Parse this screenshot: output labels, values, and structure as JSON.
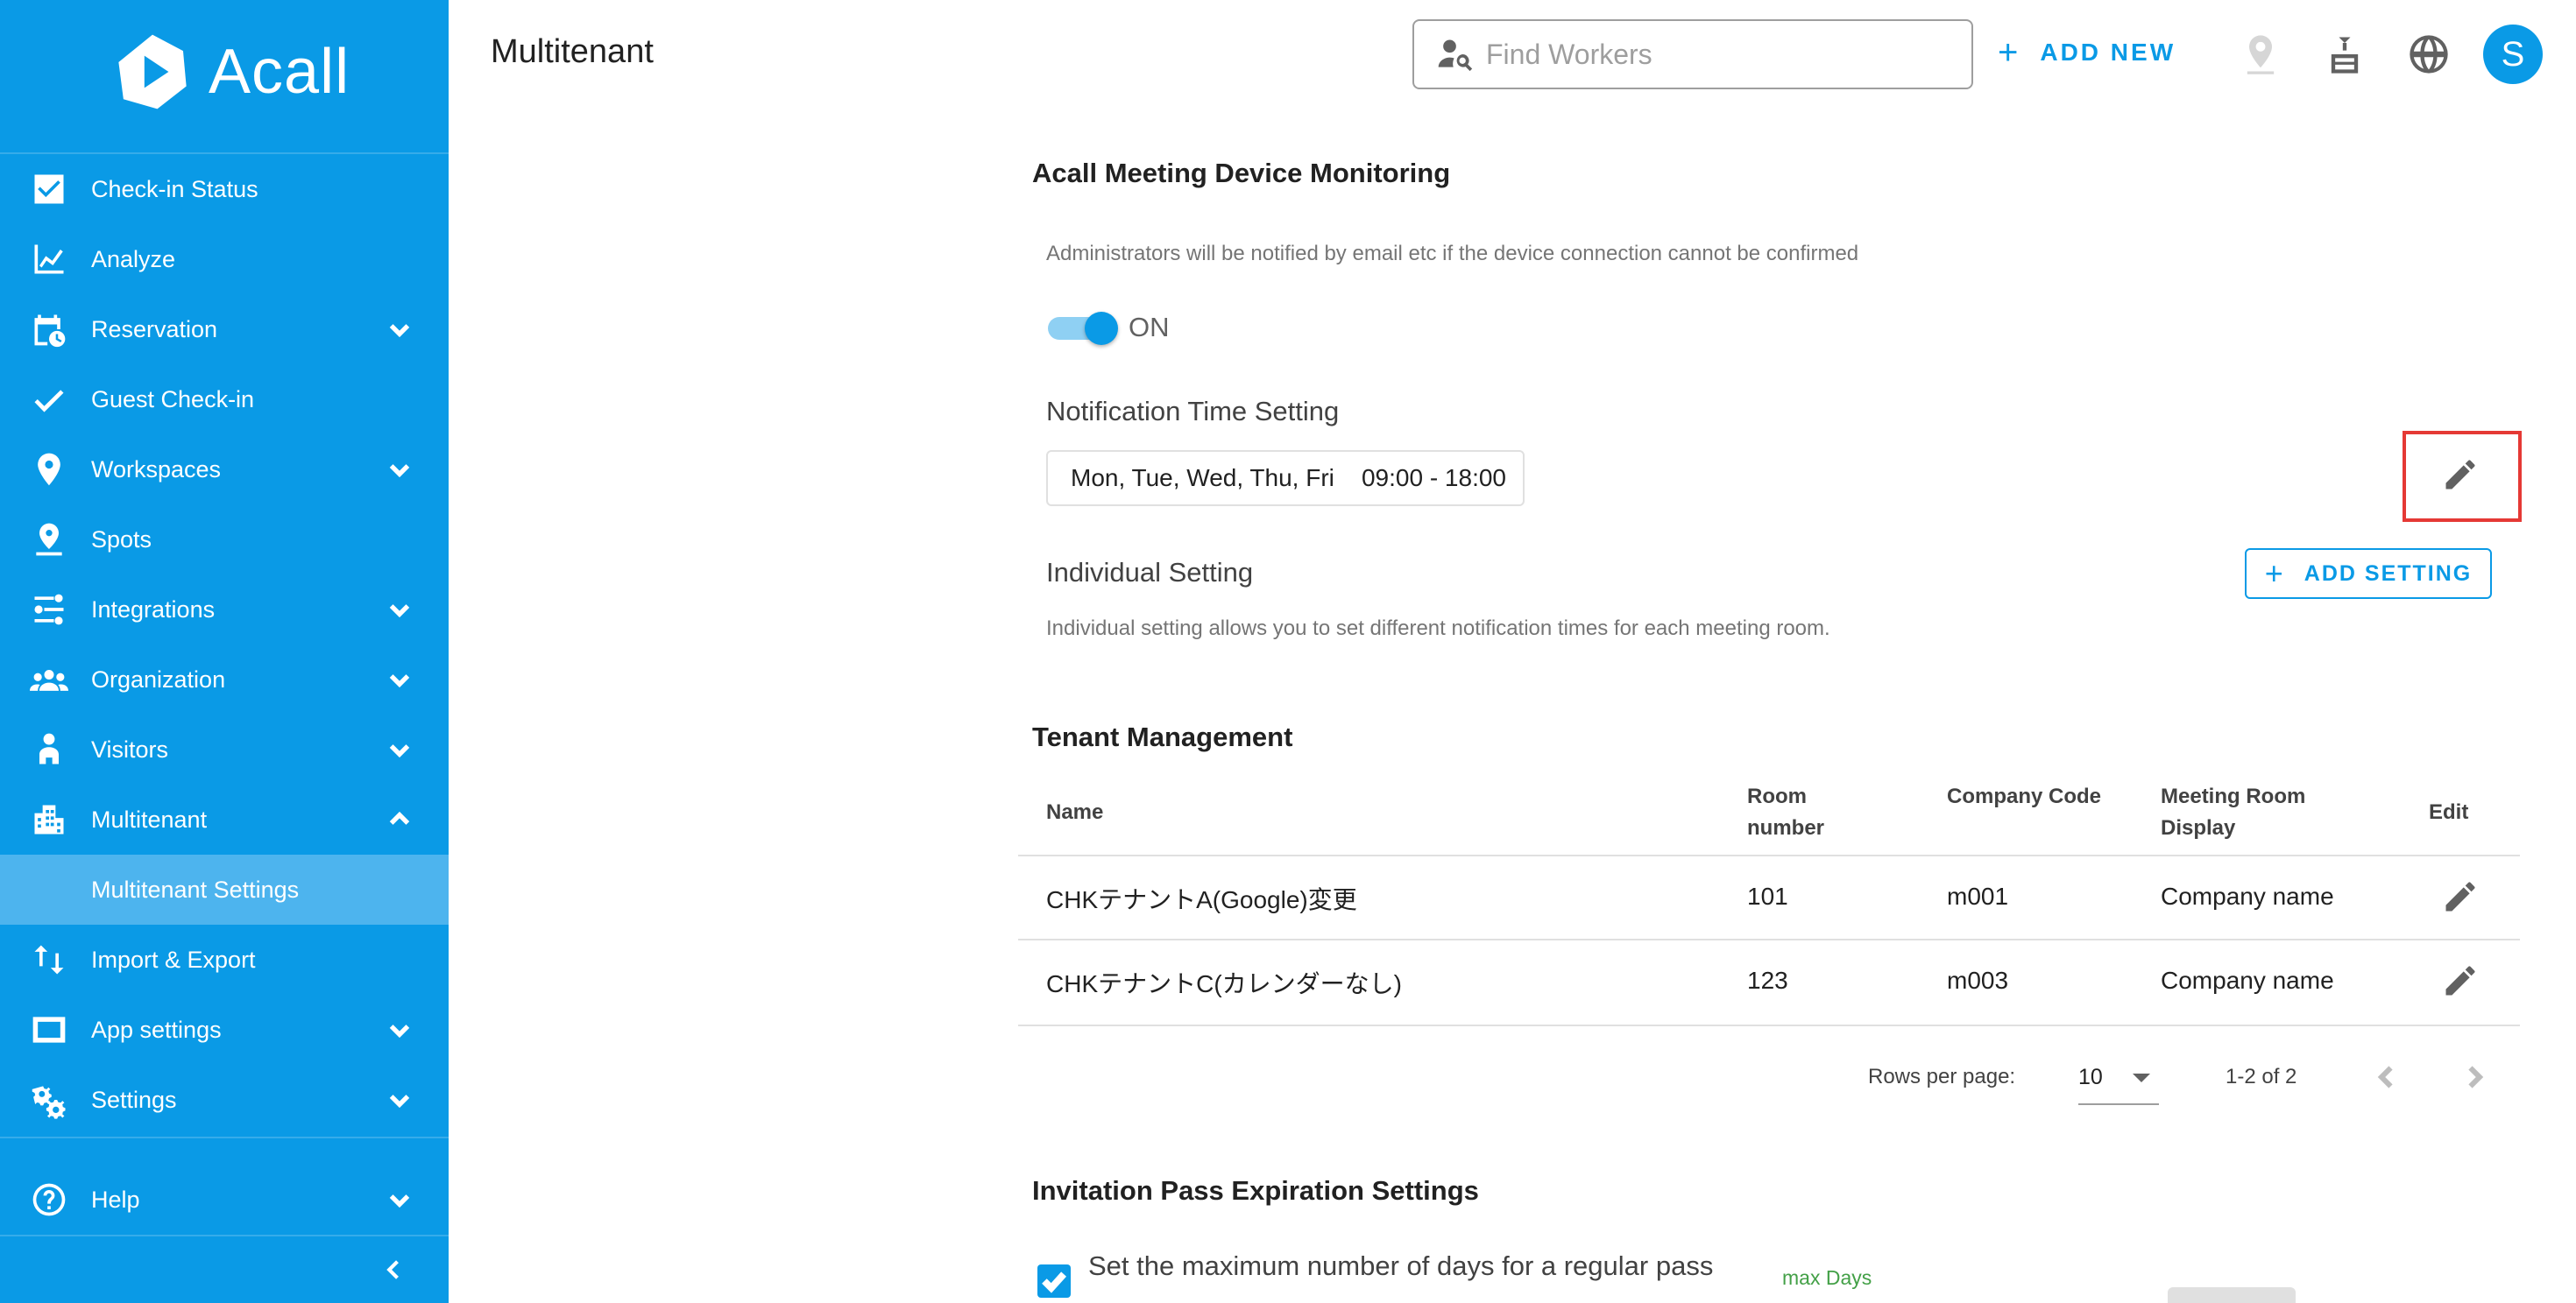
{
  "app": {
    "logo_text": "Acall",
    "page_title": "Multitenant"
  },
  "header": {
    "search_placeholder": "Find Workers",
    "add_new_label": "ADD NEW",
    "avatar_initial": "S"
  },
  "sidebar": {
    "items": [
      {
        "label": "Check-in Status",
        "icon": "checkbox-icon",
        "expandable": false
      },
      {
        "label": "Analyze",
        "icon": "chart-line-icon",
        "expandable": false
      },
      {
        "label": "Reservation",
        "icon": "calendar-clock-icon",
        "expandable": true
      },
      {
        "label": "Guest Check-in",
        "icon": "check-icon",
        "expandable": false
      },
      {
        "label": "Workspaces",
        "icon": "location-pin-icon",
        "expandable": true
      },
      {
        "label": "Spots",
        "icon": "spot-pin-icon",
        "expandable": false
      },
      {
        "label": "Integrations",
        "icon": "integrations-icon",
        "expandable": true
      },
      {
        "label": "Organization",
        "icon": "people-icon",
        "expandable": true
      },
      {
        "label": "Visitors",
        "icon": "visitor-icon",
        "expandable": true
      },
      {
        "label": "Multitenant",
        "icon": "building-icon",
        "expandable": true,
        "expanded": true
      }
    ],
    "active_sub": "Multitenant Settings",
    "items_after": [
      {
        "label": "Import & Export",
        "icon": "import-export-icon",
        "expandable": false
      },
      {
        "label": "App settings",
        "icon": "app-window-icon",
        "expandable": true
      },
      {
        "label": "Settings",
        "icon": "gears-icon",
        "expandable": true
      }
    ],
    "help_label": "Help"
  },
  "monitoring": {
    "title": "Acall Meeting Device Monitoring",
    "description": "Administrators will be notified by email etc if the device connection cannot be confirmed",
    "toggle_label": "ON",
    "toggle_on": true,
    "notification_title": "Notification Time Setting",
    "notification_value": "Mon, Tue, Wed, Thu, Fri    09:00 - 18:00",
    "individual_title": "Individual Setting",
    "individual_description": "Individual setting allows you to set different notification times for each meeting room.",
    "add_setting_label": "ADD SETTING"
  },
  "tenant": {
    "title": "Tenant Management",
    "columns": {
      "name": "Name",
      "room_line1": "Room",
      "room_line2": "number",
      "company_code": "Company Code",
      "display_line1": "Meeting Room",
      "display_line2": "Display",
      "edit": "Edit"
    },
    "rows": [
      {
        "name": "CHKテナントA(Google)変更",
        "room": "101",
        "code": "m001",
        "display": "Company name"
      },
      {
        "name": "CHKテナントC(カレンダーなし)",
        "room": "123",
        "code": "m003",
        "display": "Company name"
      }
    ],
    "rows_per_page_label": "Rows per page:",
    "rows_per_page_value": "10",
    "range_label": "1-2 of 2"
  },
  "invitation": {
    "title": "Invitation Pass Expiration Settings",
    "checkbox_label": "Set the maximum number of days for a regular pass",
    "checked": true,
    "max_days_label": "max Days"
  },
  "colors": {
    "primary": "#0a9ae6",
    "sidebar_active": "#4db4ee",
    "highlight": "#e53935"
  }
}
